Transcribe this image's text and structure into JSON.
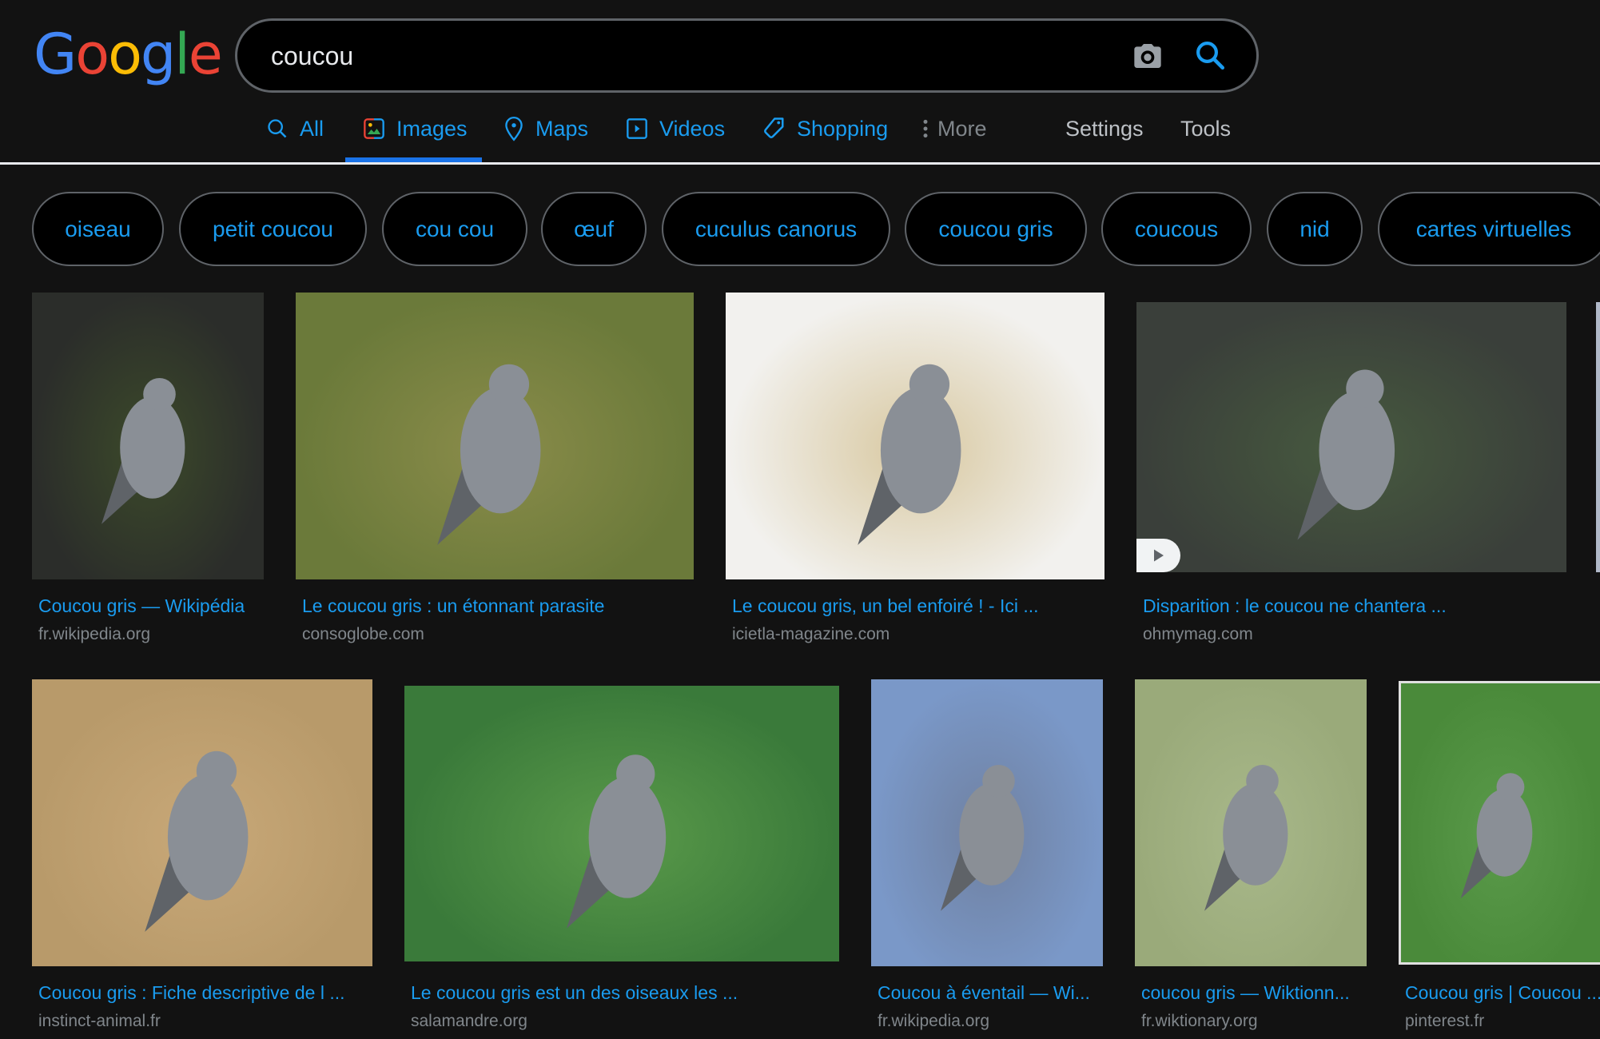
{
  "logo": {
    "letters": [
      "G",
      "o",
      "o",
      "g",
      "l",
      "e"
    ],
    "colors": [
      "#4285f4",
      "#ea4335",
      "#fbbc05",
      "#4285f4",
      "#34a853",
      "#ea4335"
    ]
  },
  "search": {
    "query": "coucou",
    "camera_icon": "camera-icon",
    "search_icon": "search-icon"
  },
  "tabs": [
    {
      "label": "All",
      "icon": "search-icon"
    },
    {
      "label": "Images",
      "icon": "image-icon",
      "active": true
    },
    {
      "label": "Maps",
      "icon": "map-pin-icon"
    },
    {
      "label": "Videos",
      "icon": "play-box-icon"
    },
    {
      "label": "Shopping",
      "icon": "tag-icon"
    },
    {
      "label": "More",
      "icon": "more-vert-icon"
    },
    {
      "label": "Settings"
    },
    {
      "label": "Tools"
    }
  ],
  "chips": [
    "oiseau",
    "petit coucou",
    "cou cou",
    "œuf",
    "cuculus canorus",
    "coucou gris",
    "coucous",
    "nid",
    "cartes virtuelles"
  ],
  "results": [
    {
      "title": "Coucou gris — Wikipédia",
      "source": "fr.wikipedia.org",
      "colors": [
        "#2b2d2a",
        "#3c4a2a",
        "#4a7a3a"
      ]
    },
    {
      "title": "Le coucou gris : un étonnant parasite",
      "source": "consoglobe.com",
      "colors": [
        "#6b7a3a",
        "#8a8c4a",
        "#b0924a"
      ]
    },
    {
      "title": "Le coucou gris, un bel enfoiré ! - Ici ...",
      "source": "icietla-magazine.com",
      "colors": [
        "#f2f1ee",
        "#d8c8a0",
        "#b8a070"
      ]
    },
    {
      "title": "Disparition : le coucou ne chantera ...",
      "source": "ohmymag.com",
      "colors": [
        "#3a3f3a",
        "#475a3f",
        "#3e6a35"
      ],
      "has_video": true
    },
    {
      "title": "Coucou gris : Fiche descriptive de l ...",
      "source": "instinct-animal.fr",
      "colors": [
        "#b89a6a",
        "#c8a878",
        "#a8885a"
      ]
    },
    {
      "title": "Le coucou gris est un des oiseaux les ...",
      "source": "salamandre.org",
      "colors": [
        "#3a7a3a",
        "#5a9a4a",
        "#7aa86a"
      ]
    },
    {
      "title": "Coucou à éventail — Wi...",
      "source": "fr.wikipedia.org",
      "colors": [
        "#7a98c8",
        "#6f80a0",
        "#6a6a5a"
      ]
    },
    {
      "title": "coucou gris — Wiktionn...",
      "source": "fr.wiktionary.org",
      "colors": [
        "#9aaa7a",
        "#a8b88a",
        "#8aa8a0"
      ]
    },
    {
      "title": "Coucou gris | Coucou ...",
      "source": "pinterest.fr",
      "colors": [
        "#4a8a3a",
        "#5a9a4a",
        "#3a7a30"
      ]
    }
  ],
  "bird_colors": {
    "body": "#8a8f96",
    "wing": "#5f6368"
  }
}
